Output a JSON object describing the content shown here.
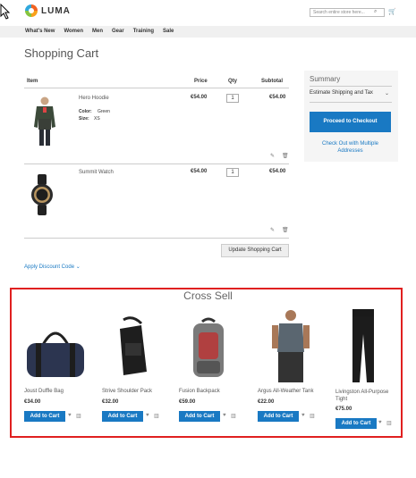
{
  "header": {
    "logo_text": "LUMA",
    "search_placeholder": "Search entire store here...",
    "nav": [
      "What's New",
      "Women",
      "Men",
      "Gear",
      "Training",
      "Sale"
    ]
  },
  "page_title": "Shopping Cart",
  "cart": {
    "columns": {
      "item": "Item",
      "price": "Price",
      "qty": "Qty",
      "subtotal": "Subtotal"
    },
    "items": [
      {
        "name": "Hero Hoodie",
        "color_label": "Color:",
        "color": "Green",
        "size_label": "Size:",
        "size": "XS",
        "price": "€54.00",
        "qty": "1",
        "subtotal": "€54.00"
      },
      {
        "name": "Summit Watch",
        "price": "€54.00",
        "qty": "1",
        "subtotal": "€54.00"
      }
    ],
    "update_label": "Update Shopping Cart",
    "discount_label": "Apply Discount Code"
  },
  "summary": {
    "title": "Summary",
    "shipping_label": "Estimate Shipping and Tax",
    "checkout_label": "Proceed to Checkout",
    "multi_label": "Check Out with Multiple Addresses"
  },
  "cross_sell": {
    "title": "Cross Sell",
    "add_label": "Add to Cart",
    "products": [
      {
        "name": "Joust Duffle Bag",
        "price": "€34.00"
      },
      {
        "name": "Strive Shoulder Pack",
        "price": "€32.00"
      },
      {
        "name": "Fusion Backpack",
        "price": "€59.00"
      },
      {
        "name": "Argus All-Weather Tank",
        "price": "€22.00"
      },
      {
        "name": "Livingston All-Purpose Tight",
        "price": "€75.00"
      }
    ]
  },
  "colors": {
    "accent": "#1979c3",
    "highlight_border": "#e02020"
  }
}
